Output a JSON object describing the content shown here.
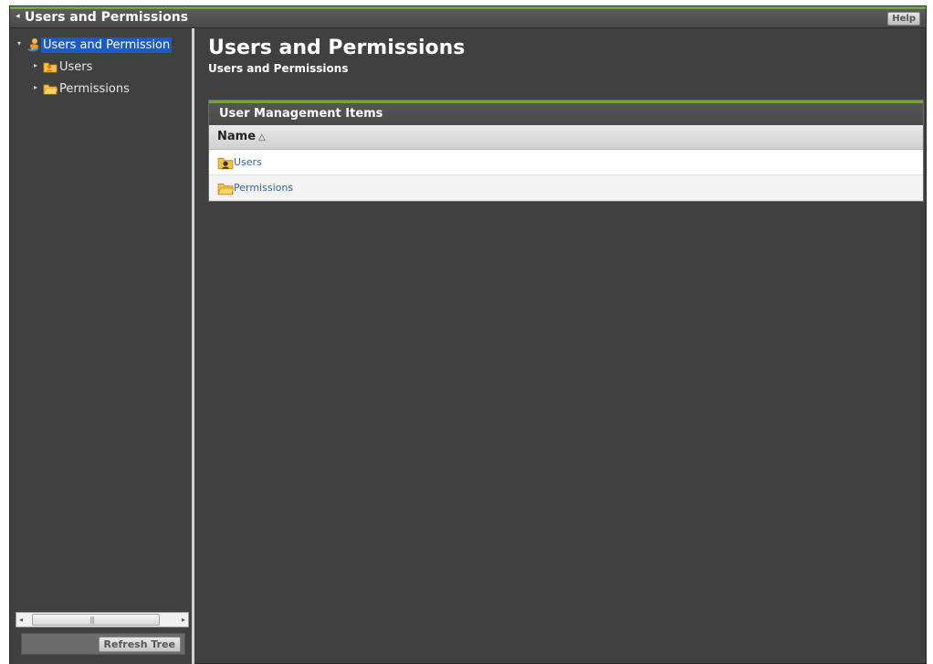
{
  "titlebar": {
    "title": "Users and Permissions",
    "back_glyph": "◂",
    "help_label": "Help"
  },
  "sidebar": {
    "items": [
      {
        "label": "Users and Permission",
        "icon": "users-permissions-icon",
        "selected": true,
        "expanded": true
      },
      {
        "label": "Users",
        "icon": "users-folder-icon"
      },
      {
        "label": "Permissions",
        "icon": "folder-icon"
      }
    ],
    "refresh_label": "Refresh Tree"
  },
  "main": {
    "title": "Users and Permissions",
    "subtitle": "Users and Permissions",
    "panel": {
      "header": "User Management Items",
      "column": "Name",
      "sort_glyph": "△",
      "rows": [
        {
          "label": "Users",
          "icon": "users-folder-icon"
        },
        {
          "label": "Permissions",
          "icon": "folder-icon"
        }
      ]
    }
  },
  "colors": {
    "accent_green": "#6fa83a",
    "selection_blue": "#1d5ac9",
    "link_blue": "#2a66b8",
    "background": "#404040"
  }
}
